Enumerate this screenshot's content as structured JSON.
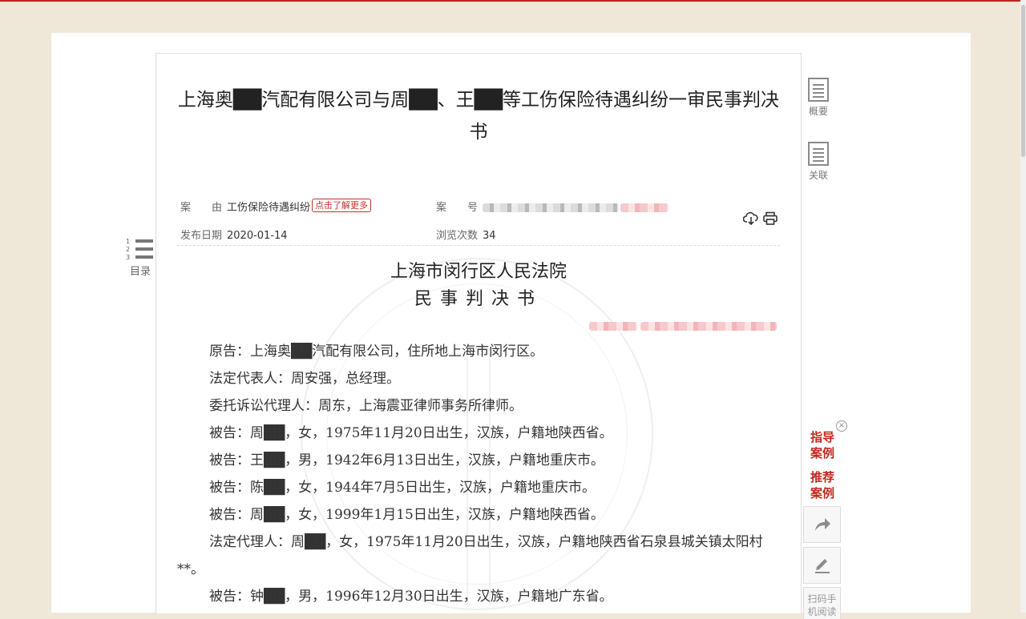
{
  "document": {
    "title": "上海奥██汽配有限公司与周██、王██等工伤保险待遇纠纷一审民事判决书",
    "meta": {
      "cause_label": "案　　由",
      "cause_value": "工伤保险待遇纠纷",
      "learn_more": "点击了解更多",
      "case_no_label": "案　　号",
      "date_label": "发布日期",
      "date_value": "2020-01-14",
      "views_label": "浏览次数",
      "views_value": "34"
    },
    "court": "上海市闵行区人民法院",
    "doc_type": "民事判决书",
    "paragraphs": [
      "原告：上海奥██汽配有限公司，住所地上海市闵行区。",
      "法定代表人：周安强，总经理。",
      "委托诉讼代理人：周东，上海震亚律师事务所律师。",
      "被告：周██，女，1975年11月20日出生，汉族，户籍地陕西省。",
      "被告：王██，男，1942年6月13日出生，汉族，户籍地重庆市。",
      "被告：陈██，女，1944年7月5日出生，汉族，户籍地重庆市。",
      "被告：周██，女，1999年1月15日出生，汉族，户籍地陕西省。",
      "法定代理人：周██，女，1975年11月20日出生，汉族，户籍地陕西省石泉县城关镇太阳村**。",
      "被告：钟██，男，1996年12月30日出生，汉族，户籍地广东省。"
    ]
  },
  "sidebar_left": {
    "toc_numbers": [
      "1",
      "2",
      "3"
    ],
    "toc_label": "目录"
  },
  "sidebar_right": {
    "summary_label": "概要",
    "related_label": "关联",
    "guiding_cases": "指导案例",
    "recommended_cases": "推荐案例",
    "qr_label": "扫码手机阅读"
  },
  "icons": {
    "download": "download-icon",
    "print": "print-icon",
    "share": "share-icon",
    "edit": "edit-icon",
    "close": "close-icon"
  },
  "colors": {
    "accent": "#c0281f",
    "background": "#efe7d8"
  }
}
